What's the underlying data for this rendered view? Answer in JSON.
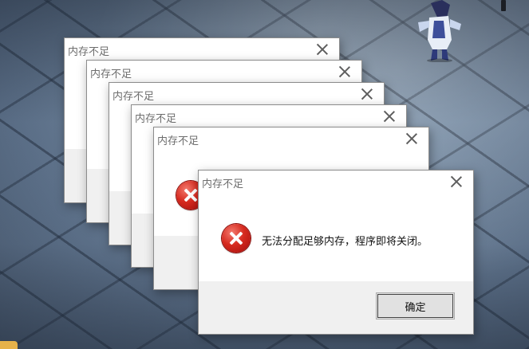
{
  "dialogs": [
    {
      "title": "内存不足"
    },
    {
      "title": "内存不足"
    },
    {
      "title": "内存不足"
    },
    {
      "title": "内存不足"
    },
    {
      "title": "内存不足"
    },
    {
      "title": "内存不足",
      "message": "无法分配足够内存，程序即将关闭。",
      "ok_label": "确定",
      "icon": "error-icon"
    }
  ],
  "colors": {
    "dialog_background": "#ffffff",
    "footer_background": "#f0f0f0",
    "title_text": "#6d6d6d",
    "error_icon": "#d62a1f"
  }
}
